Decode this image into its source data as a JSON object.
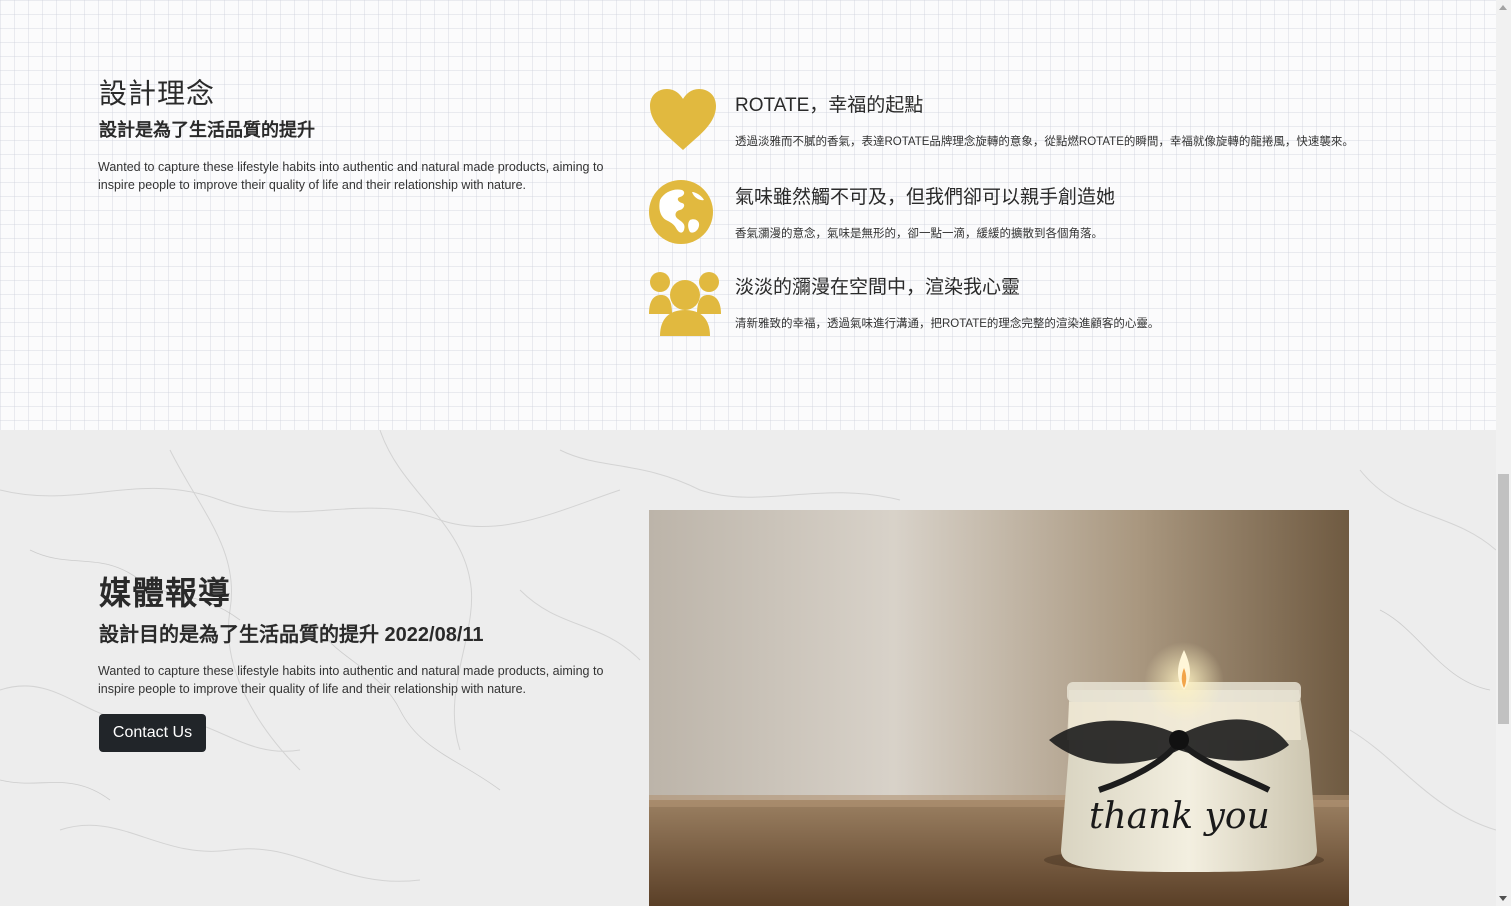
{
  "concept": {
    "title": "設計理念",
    "subtitle": "設計是為了生活品質的提升",
    "description": "Wanted to capture these lifestyle habits into authentic and natural made products, aiming to inspire people to improve their quality of life and their relationship with nature.",
    "features": [
      {
        "icon": "heart-icon",
        "title": "ROTATE，幸福的起點",
        "description": "透過淡雅而不膩的香氣，表達ROTATE品牌理念旋轉的意象，從點燃ROTATE的瞬間，幸福就像旋轉的龍捲風，快速襲來。"
      },
      {
        "icon": "globe-americas-icon",
        "title": "氣味雖然觸不可及，但我們卻可以親手創造她",
        "description": "香氣瀰漫的意念，氣味是無形的，卻一點一滴，緩緩的擴散到各個角落。"
      },
      {
        "icon": "people-group-icon",
        "title": "淡淡的瀰漫在空間中，渲染我心靈",
        "description": "清新雅致的幸福，透過氣味進行溝通，把ROTATE的理念完整的渲染進顧客的心靈。"
      }
    ]
  },
  "media": {
    "title": "媒體報導",
    "subtitle": "設計目的是為了生活品質的提升 2022/08/11",
    "description": "Wanted to capture these lifestyle habits into authentic and natural made products, aiming to inspire people to improve their quality of life and their relationship with nature.",
    "button_label": "Contact Us",
    "photo_caption": "thank you"
  },
  "colors": {
    "accent": "#e1b93f",
    "button": "#212529"
  }
}
